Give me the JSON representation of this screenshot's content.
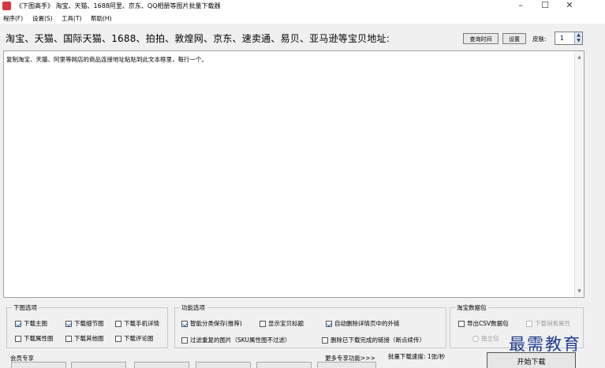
{
  "window": {
    "title": "《下图高手》 淘宝、天猫、1688阿里、京东、QQ相册等图片批量下载器",
    "minimize": "–",
    "maximize": "☐",
    "close": "✕"
  },
  "menu": [
    "程序(F)",
    "设置(S)",
    "工具(T)",
    "帮助(H)"
  ],
  "header": {
    "title": "淘宝、天猫、国际天猫、1688、拍拍、敦煌网、京东、速卖通、易贝、亚马逊等宝贝地址:",
    "query_time_button": "查询时间",
    "settings_button": "设置",
    "skin_label": "皮肤:",
    "skin_value": "1"
  },
  "url_input": {
    "text": "复制淘宝、天猫、阿里等网店的商品连接地址粘贴到此文本框里，每行一个。"
  },
  "download_options": {
    "title": "下图选项",
    "items": [
      {
        "label": "下载主图",
        "checked": true
      },
      {
        "label": "下载细节图",
        "checked": true
      },
      {
        "label": "下载手机详情",
        "checked": false
      },
      {
        "label": "下载属性图",
        "checked": false
      },
      {
        "label": "下载其他图",
        "checked": false
      },
      {
        "label": "下载评论图",
        "checked": false
      }
    ]
  },
  "function_options": {
    "title": "功能选项",
    "items": [
      {
        "label": "智能分类保存(推荐)",
        "checked": true
      },
      {
        "label": "显示宝贝标题",
        "checked": false
      },
      {
        "label": "自动删除详情页中的外链",
        "checked": true
      },
      {
        "label": "过滤重复的图片（SKU属性图不过滤）",
        "checked": false
      },
      {
        "label": "删除已下载完成的链接（断点续传）",
        "checked": false
      }
    ]
  },
  "taobao_package": {
    "title": "淘宝数据包",
    "export_csv": {
      "label": "导出CSV数据包",
      "checked": false
    },
    "download_sales_attr": {
      "label": "下载销售属性",
      "checked": false
    },
    "standalone": "独立包"
  },
  "footer": {
    "member_label": "会员专享",
    "more_features": "更多专享功能>>>",
    "batch_speed": "批量下载速度: 1张/秒",
    "start_button": "开始下载"
  },
  "watermark": "最需教育"
}
